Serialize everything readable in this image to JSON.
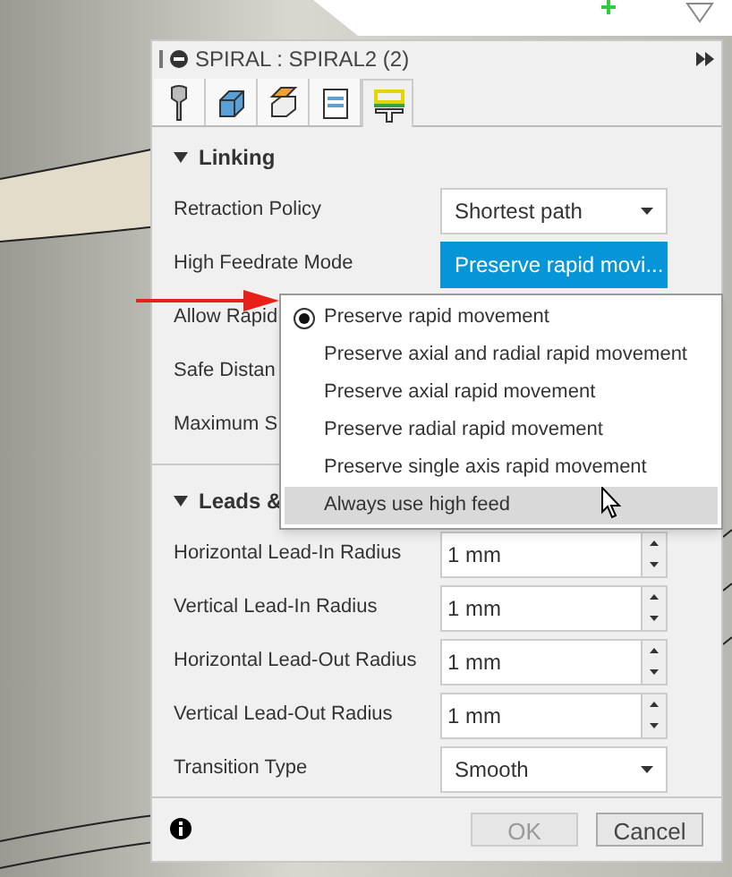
{
  "dialog": {
    "title": "SPIRAL : SPIRAL2 (2)",
    "tabs": [
      {
        "kind": "tool",
        "selected": false
      },
      {
        "kind": "geometry",
        "selected": false
      },
      {
        "kind": "heights",
        "selected": false
      },
      {
        "kind": "passes",
        "selected": false
      },
      {
        "kind": "linking",
        "selected": true
      }
    ],
    "sections": [
      {
        "title": "Linking",
        "expanded": true,
        "rows": [
          {
            "kind": "select",
            "label": "Retraction Policy",
            "value": "Shortest path",
            "focused": false
          },
          {
            "kind": "select",
            "label": "High Feedrate Mode",
            "value": "Preserve rapid movi...",
            "focused": true
          },
          {
            "kind": "covered",
            "label": "Allow Rapid"
          },
          {
            "kind": "covered",
            "label": "Safe Distan"
          },
          {
            "kind": "covered",
            "label": "Maximum S"
          }
        ]
      },
      {
        "title": "Leads &",
        "expanded": true,
        "rows": [
          {
            "kind": "spinner",
            "label": "Horizontal Lead-In Radius",
            "value": "1 mm"
          },
          {
            "kind": "spinner",
            "label": "Vertical Lead-In Radius",
            "value": "1 mm"
          },
          {
            "kind": "spinner",
            "label": "Horizontal Lead-Out Radius",
            "value": "1 mm"
          },
          {
            "kind": "spinner",
            "label": "Vertical Lead-Out Radius",
            "value": "1 mm"
          },
          {
            "kind": "select",
            "label": "Transition Type",
            "value": "Smooth",
            "focused": false
          }
        ]
      }
    ],
    "buttons": [
      {
        "label": "OK",
        "disabled": true
      },
      {
        "label": "Cancel",
        "disabled": false
      }
    ]
  },
  "menu": {
    "items": [
      {
        "label": "Preserve rapid movement",
        "selected": true,
        "highlighted": false
      },
      {
        "label": "Preserve axial and radial rapid movement",
        "selected": false,
        "highlighted": false
      },
      {
        "label": "Preserve axial rapid movement",
        "selected": false,
        "highlighted": false
      },
      {
        "label": "Preserve radial rapid movement",
        "selected": false,
        "highlighted": false
      },
      {
        "label": "Preserve single axis rapid movement",
        "selected": false,
        "highlighted": false
      },
      {
        "label": "Always use high feed",
        "selected": false,
        "highlighted": true
      }
    ]
  }
}
